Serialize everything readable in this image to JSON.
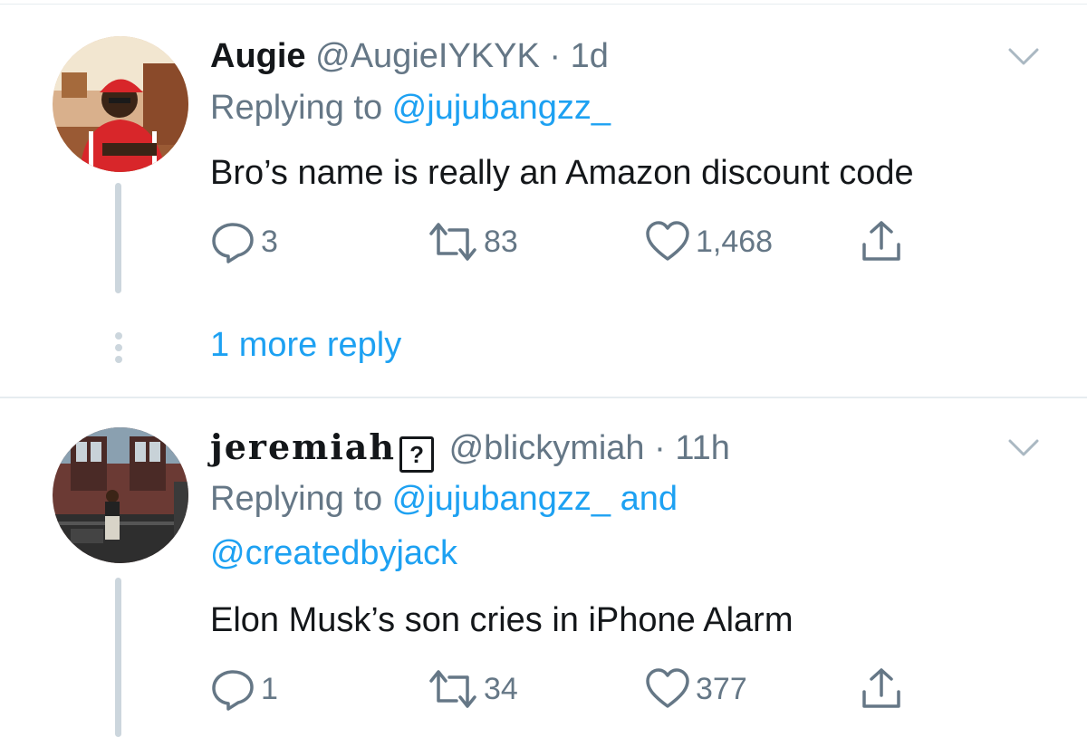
{
  "colors": {
    "accent": "#1da1f2",
    "text": "#14171a",
    "muted": "#657786",
    "thread_line": "#ccd6dd"
  },
  "tweets": [
    {
      "display_name": "Augie",
      "handle": "@AugieIYKYK",
      "separator": "·",
      "time": "1d",
      "reply_prefix": "Replying to ",
      "reply_to": "@jujubangzz_",
      "text": "Bro’s name is really an Amazon discount code",
      "replies": "3",
      "retweets": "83",
      "likes": "1,468",
      "icons": [
        "reply-icon",
        "retweet-icon",
        "like-icon",
        "share-icon",
        "chevron-down-icon"
      ]
    },
    {
      "display_name": "jeremiah",
      "badge": "?",
      "handle": "@blickymiah",
      "separator": "·",
      "time": "11h",
      "reply_prefix": "Replying to ",
      "reply_to": "@jujubangzz_",
      "reply_join": " and",
      "reply_to_2": "@createdbyjack",
      "text": "Elon Musk’s son cries in iPhone Alarm",
      "replies": "1",
      "retweets": "34",
      "likes": "377",
      "icons": [
        "reply-icon",
        "retweet-icon",
        "like-icon",
        "share-icon",
        "chevron-down-icon"
      ]
    }
  ],
  "thread": {
    "more_replies": "1 more reply"
  }
}
